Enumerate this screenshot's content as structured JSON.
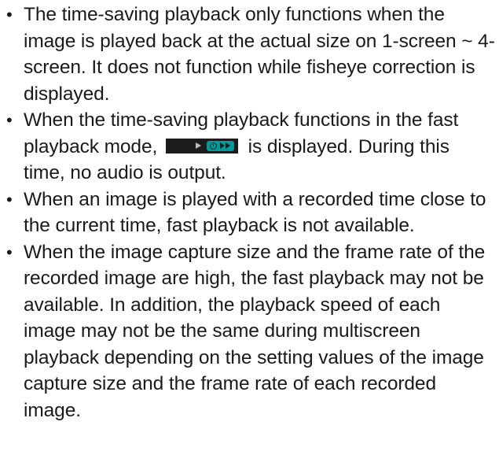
{
  "notes": [
    {
      "text": "The time-saving playback only functions when the image is played back at the actual size on 1-screen ~ 4-screen. It does not function while fisheye correction is displayed."
    },
    {
      "text_before": "When the time-saving playback functions in the fast playback mode,",
      "text_after": "is displayed. During this time, no audio is output.",
      "indicator_icon": "time-saving-fast-playback-indicator-icon",
      "indicator_colors": {
        "background": "#1c1c1c",
        "play_arrow": "#bdbdbd",
        "pill": "#009a9a",
        "glyphs": "#0b1f1f"
      }
    },
    {
      "text": "When an image is played with a recorded time close to the current time, fast playback is not available."
    },
    {
      "text": "When the image capture size and the frame rate of the recorded image are high, the fast playback may not be available. In addition, the playback speed of each image may not be the same during multiscreen playback depending on the setting values of the image capture size and the frame rate of each recorded image."
    }
  ],
  "bullet_char": "•"
}
